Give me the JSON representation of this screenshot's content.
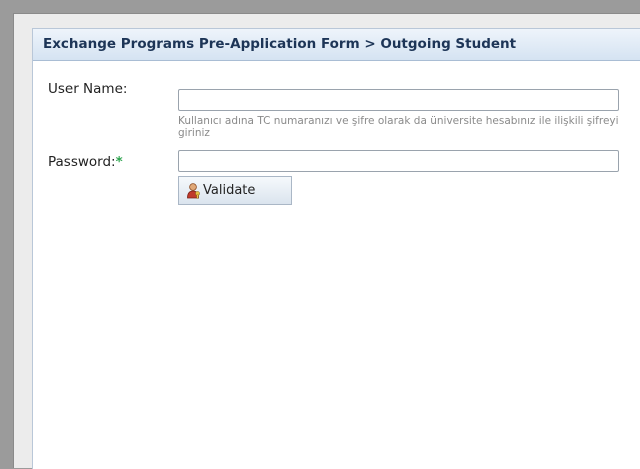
{
  "form": {
    "title": "Exchange Programs Pre-Application Form > Outgoing Student",
    "username_label": "User Name:",
    "username_value": "",
    "username_hint": "Kullanıcı adına TC numaranızı ve şifre olarak da üniversite hesabınız ile ilişkili şifreyi giriniz",
    "password_label": "Password:",
    "password_required_mark": "*",
    "password_value": "",
    "validate_label": "Validate",
    "validate_icon": "user-key-icon"
  },
  "colors": {
    "header_text": "#1d3557",
    "required_mark": "#2ea44f",
    "hint_text": "#8a8a8a"
  }
}
